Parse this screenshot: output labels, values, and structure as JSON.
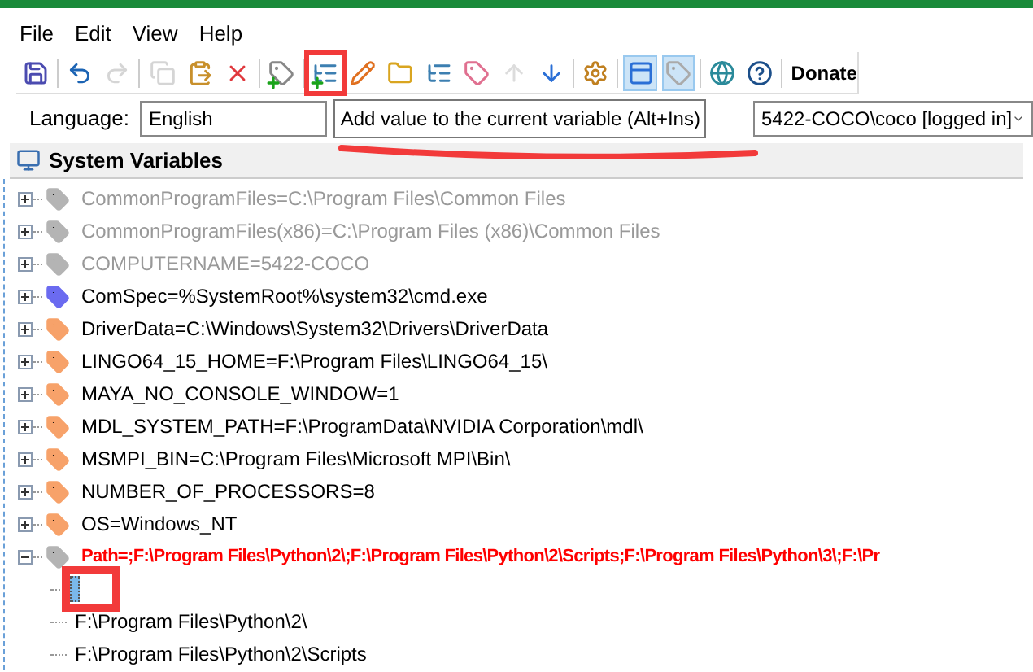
{
  "menu": [
    {
      "label": "File"
    },
    {
      "label": "Edit"
    },
    {
      "label": "View"
    },
    {
      "label": "Help"
    }
  ],
  "toolbar": {
    "buttons": [
      {
        "disabled": false,
        "selected": false,
        "circled": false
      },
      {
        "disabled": false,
        "selected": false,
        "circled": false
      },
      {
        "disabled": true,
        "selected": false,
        "circled": false
      },
      {
        "disabled": true,
        "selected": false,
        "circled": false
      },
      {
        "disabled": false,
        "selected": false,
        "circled": false
      },
      {
        "disabled": false,
        "selected": false,
        "circled": false
      },
      {
        "disabled": false,
        "selected": false,
        "circled": false
      },
      {
        "disabled": false,
        "selected": false,
        "circled": true
      },
      {
        "disabled": false,
        "selected": false,
        "circled": false
      },
      {
        "disabled": false,
        "selected": false,
        "circled": false
      },
      {
        "disabled": false,
        "selected": false,
        "circled": false
      },
      {
        "disabled": false,
        "selected": false,
        "circled": false
      },
      {
        "disabled": true,
        "selected": false,
        "circled": false
      },
      {
        "disabled": false,
        "selected": false,
        "circled": false
      },
      {
        "disabled": false,
        "selected": false,
        "circled": false
      },
      {
        "disabled": false,
        "selected": true,
        "circled": false
      },
      {
        "disabled": false,
        "selected": true,
        "circled": false
      },
      {
        "disabled": false,
        "selected": false,
        "circled": false
      },
      {
        "disabled": false,
        "selected": false,
        "circled": false
      }
    ],
    "donate": "Donate"
  },
  "language": {
    "label": "Language:",
    "value": "English"
  },
  "tooltip": {
    "text": "Add value to the current variable (Alt+Ins)",
    "underlined": true
  },
  "user": {
    "value": "5422-COCO\\coco [logged in]"
  },
  "section": {
    "title": "System Variables"
  },
  "variables": [
    {
      "text": "CommonProgramFiles=C:\\Program Files\\Common Files",
      "color": "#b4b4b4",
      "disabled": true,
      "highlighted": false,
      "expanded": false
    },
    {
      "text": "CommonProgramFiles(x86)=C:\\Program Files (x86)\\Common Files",
      "color": "#b4b4b4",
      "disabled": true,
      "highlighted": false,
      "expanded": false
    },
    {
      "text": "COMPUTERNAME=5422-COCO",
      "color": "#b4b4b4",
      "disabled": true,
      "highlighted": false,
      "expanded": false
    },
    {
      "text": "ComSpec=%SystemRoot%\\system32\\cmd.exe",
      "color": "#6b6bf0",
      "disabled": false,
      "highlighted": false,
      "expanded": false
    },
    {
      "text": "DriverData=C:\\Windows\\System32\\Drivers\\DriverData",
      "color": "#f7a26a",
      "disabled": false,
      "highlighted": false,
      "expanded": false
    },
    {
      "text": "LINGO64_15_HOME=F:\\Program Files\\LINGO64_15\\",
      "color": "#f7a26a",
      "disabled": false,
      "highlighted": false,
      "expanded": false
    },
    {
      "text": "MAYA_NO_CONSOLE_WINDOW=1",
      "color": "#f7a26a",
      "disabled": false,
      "highlighted": false,
      "expanded": false
    },
    {
      "text": "MDL_SYSTEM_PATH=F:\\ProgramData\\NVIDIA Corporation\\mdl\\",
      "color": "#f7a26a",
      "disabled": false,
      "highlighted": false,
      "expanded": false
    },
    {
      "text": "MSMPI_BIN=C:\\Program Files\\Microsoft MPI\\Bin\\",
      "color": "#f7a26a",
      "disabled": false,
      "highlighted": false,
      "expanded": false
    },
    {
      "text": "NUMBER_OF_PROCESSORS=8",
      "color": "#f7a26a",
      "disabled": false,
      "highlighted": false,
      "expanded": false
    },
    {
      "text": "OS=Windows_NT",
      "color": "#f7a26a",
      "disabled": false,
      "highlighted": false,
      "expanded": false
    },
    {
      "text": "Path=;F:\\Program Files\\Python\\2\\;F:\\Program Files\\Python\\2\\Scripts;F:\\Program Files\\Python\\3\\;F:\\Pr",
      "color": "#b4b4b4",
      "disabled": false,
      "highlighted": true,
      "expanded": true,
      "children": [
        {
          "kind": "editing",
          "circled": true
        },
        {
          "kind": "value",
          "text": "F:\\Program Files\\Python\\2\\",
          "circled": false
        },
        {
          "kind": "value",
          "text": "F:\\Program Files\\Python\\2\\Scripts",
          "circled": false
        }
      ]
    }
  ]
}
